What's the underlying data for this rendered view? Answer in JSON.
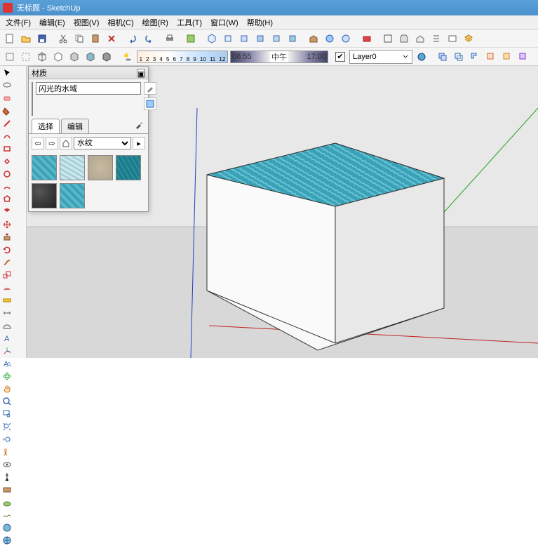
{
  "window": {
    "title": "无标题 - SketchUp"
  },
  "menu": {
    "file": "文件(F)",
    "edit": "编辑(E)",
    "view": "视图(V)",
    "camera": "相机(C)",
    "draw": "绘图(R)",
    "tools": "工具(T)",
    "window": "窗口(W)",
    "help": "帮助(H)"
  },
  "toolbar2": {
    "shadow_ticks": [
      "1",
      "2",
      "3",
      "4",
      "5",
      "6",
      "7",
      "8",
      "9",
      "10",
      "11",
      "12"
    ],
    "time_start": "06:55",
    "time_mid": "中午",
    "time_end": "17:00"
  },
  "layers": {
    "current": "Layer0"
  },
  "materials": {
    "panel_title": "材质",
    "current_name": "闪光的水域",
    "tab_select": "选择",
    "tab_edit": "编辑",
    "category": "水纹"
  }
}
